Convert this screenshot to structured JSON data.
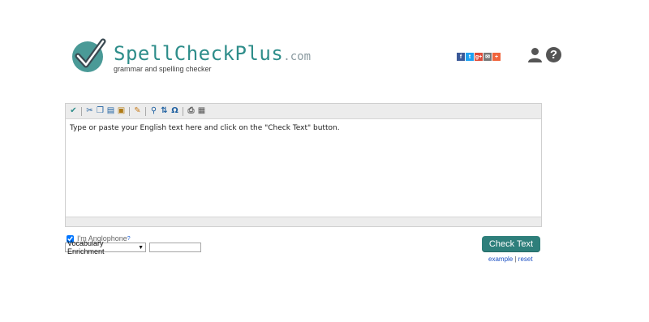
{
  "header": {
    "brand_name": "SpellCheckPlus",
    "brand_tld": ".com",
    "tagline": "grammar and spelling checker",
    "logo_icon": "check-circle-logo"
  },
  "social": [
    {
      "name": "facebook-icon",
      "glyph": "f",
      "color": "#3b5998"
    },
    {
      "name": "twitter-icon",
      "glyph": "t",
      "color": "#1da1f2"
    },
    {
      "name": "google-plus-icon",
      "glyph": "g+",
      "color": "#dd4b39"
    },
    {
      "name": "email-icon",
      "glyph": "✉",
      "color": "#777777"
    },
    {
      "name": "share-plus-icon",
      "glyph": "+",
      "color": "#f0643c"
    }
  ],
  "editor": {
    "text": "Type or paste your English text here and click on the \"Check Text\" button."
  },
  "options": {
    "anglophone_label": "I'm Anglophone",
    "anglophone_help": "?",
    "anglophone_checked": true,
    "mode_select": "Vocabulary Enrichment",
    "mode_input_value": ""
  },
  "actions": {
    "check_label": "Check Text",
    "example_label": "example",
    "separator": " | ",
    "reset_label": "reset"
  },
  "colors": {
    "brand": "#2e8d8a",
    "button": "#2e7f7b",
    "link": "#1a4fc4"
  }
}
